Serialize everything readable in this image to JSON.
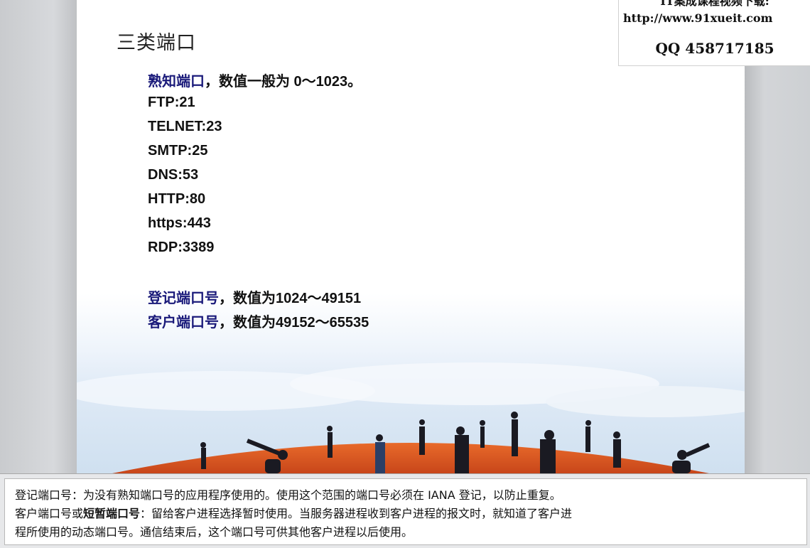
{
  "slide": {
    "title": "三类端口",
    "well_known_heading": "熟知端口",
    "well_known_desc": "，数值一般为 0～1023。",
    "ports": [
      "FTP:21",
      "TELNET:23",
      "SMTP:25",
      "DNS:53",
      "HTTP:80",
      "https:443",
      "RDP:3389"
    ],
    "registered_heading": "登记端口号",
    "registered_desc": "，数值为1024～49151",
    "client_heading": "客户端口号",
    "client_desc": "，数值为49152～65535"
  },
  "watermark": {
    "line1": "IT案成课程视频下载:",
    "url": "http://www.91xueit.com",
    "qq": "QQ 458717185"
  },
  "notes": {
    "line1": "登记端口号：为没有熟知端口号的应用程序使用的。使用这个范围的端口号必须在 IANA 登记，以防止重复。",
    "line2_pre": "客户端口号或",
    "line2_bold": "短暂端口号",
    "line2_post": "：留给客户进程选择暂时使用。当服务器进程收到客户进程的报文时，就知道了客户进",
    "line3": "程所使用的动态端口号。通信结束后，这个端口号可供其他客户进程以后使用。"
  }
}
